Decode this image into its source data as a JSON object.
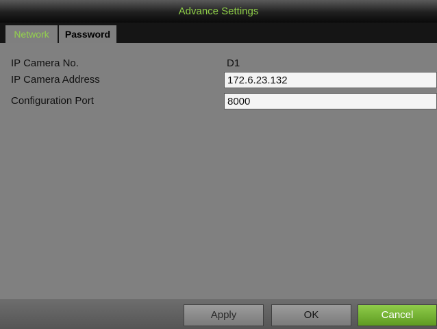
{
  "window": {
    "title": "Advance Settings"
  },
  "tabs": [
    {
      "label": "Network",
      "active": true
    },
    {
      "label": "Password",
      "active": false
    }
  ],
  "form": {
    "camera_no": {
      "label": "IP Camera No.",
      "value": "D1"
    },
    "address": {
      "label": "IP Camera Address",
      "value": "172.6.23.132"
    },
    "port": {
      "label": "Configuration Port",
      "value": "8000"
    }
  },
  "buttons": {
    "apply": "Apply",
    "ok": "OK",
    "cancel": "Cancel"
  },
  "colors": {
    "accent": "#8fcf48",
    "background": "#7f7f7f",
    "titlebar": "#1a1a1a"
  }
}
